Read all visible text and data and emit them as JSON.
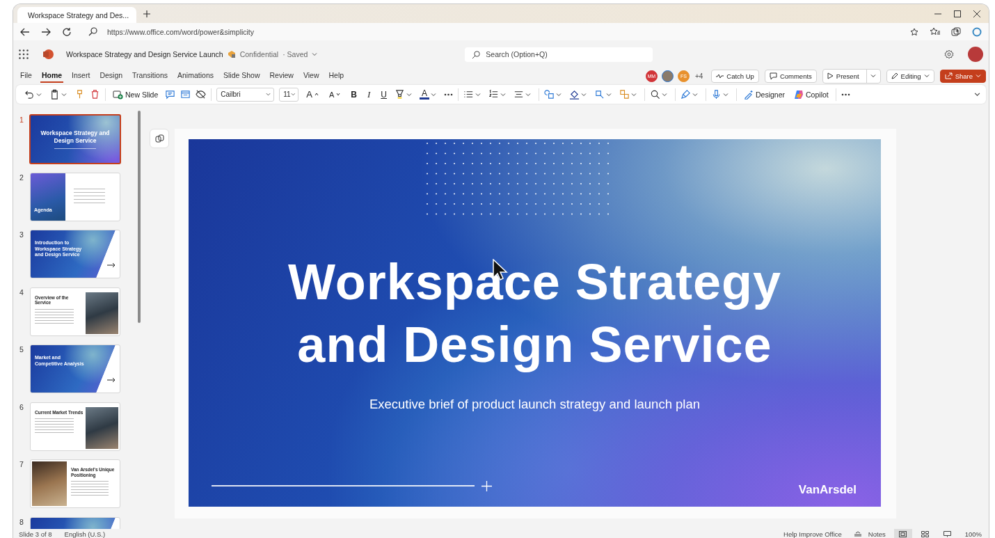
{
  "browser": {
    "tab_title": "Workspace Strategy and Des...",
    "url": "https://www.office.com/word/power&simplicity"
  },
  "app": {
    "document_title": "Workspace Strategy and Design Service Launch",
    "sensitivity": "Confidential",
    "save_status": "· Saved",
    "search": {
      "placeholder": "Search (Option+Q)"
    }
  },
  "menu_tabs": [
    {
      "label": "File",
      "selected": false
    },
    {
      "label": "Home",
      "selected": true
    },
    {
      "label": "Insert",
      "selected": false
    },
    {
      "label": "Design",
      "selected": false
    },
    {
      "label": "Transitions",
      "selected": false
    },
    {
      "label": "Animations",
      "selected": false
    },
    {
      "label": "Slide Show",
      "selected": false
    },
    {
      "label": "Review",
      "selected": false
    },
    {
      "label": "View",
      "selected": false
    },
    {
      "label": "Help",
      "selected": false
    }
  ],
  "collaborators": [
    {
      "kind": "initials",
      "initials": "MM",
      "color": "#d13438"
    },
    {
      "kind": "photo",
      "color": "#2b78d6"
    },
    {
      "kind": "initials",
      "initials": "FS",
      "color": "#e8912d"
    }
  ],
  "more_collaborators": "+4",
  "actions": [
    {
      "kind": "icon",
      "label": "Catch Up"
    },
    {
      "kind": "icon",
      "label": "Comments"
    },
    {
      "kind": "split",
      "label": "Present"
    },
    {
      "kind": "dropdown",
      "label": "Editing"
    },
    {
      "kind": "primary",
      "label": "Share"
    }
  ],
  "ribbon": {
    "new_slide": "New Slide",
    "font": "Cailbri",
    "font_size": "11",
    "grow_font": "A",
    "shrink_font": "A",
    "bold": "B",
    "italic": "I",
    "underline": "U",
    "font_color": "A",
    "designer": "Designer",
    "copilot": "Copilot"
  },
  "slides": [
    {
      "number": "1",
      "selected": true,
      "kind": "title",
      "title": "Workspace Strategy and Design Service"
    },
    {
      "number": "2",
      "selected": false,
      "kind": "agenda",
      "title": "Agenda"
    },
    {
      "number": "3",
      "selected": false,
      "kind": "section",
      "title": "Introduction to Workspace Strategy and Design Service"
    },
    {
      "number": "4",
      "selected": false,
      "kind": "content",
      "title": "Overview of the Service"
    },
    {
      "number": "5",
      "selected": false,
      "kind": "section",
      "title": "Market and Competitive Analysis"
    },
    {
      "number": "6",
      "selected": false,
      "kind": "content",
      "title": "Current Market Trends"
    },
    {
      "number": "7",
      "selected": false,
      "kind": "photo-left",
      "title": "Van Arsdel's Unique Positioning"
    },
    {
      "number": "8",
      "selected": false,
      "kind": "section"
    }
  ],
  "slide": {
    "title": "Workspace Strategy and Design Service",
    "subtitle": "Executive brief of product launch strategy and launch plan",
    "logo": "VanArsdel"
  },
  "status_bar": {
    "slide_position": "Slide 3 of 8",
    "language": "English (U.S.)",
    "feedback": "Help Improve Office",
    "notes": "Notes",
    "view_buttons": [
      {
        "selected": true
      },
      {
        "selected": false
      },
      {
        "selected": false
      }
    ],
    "zoom": "100%"
  }
}
